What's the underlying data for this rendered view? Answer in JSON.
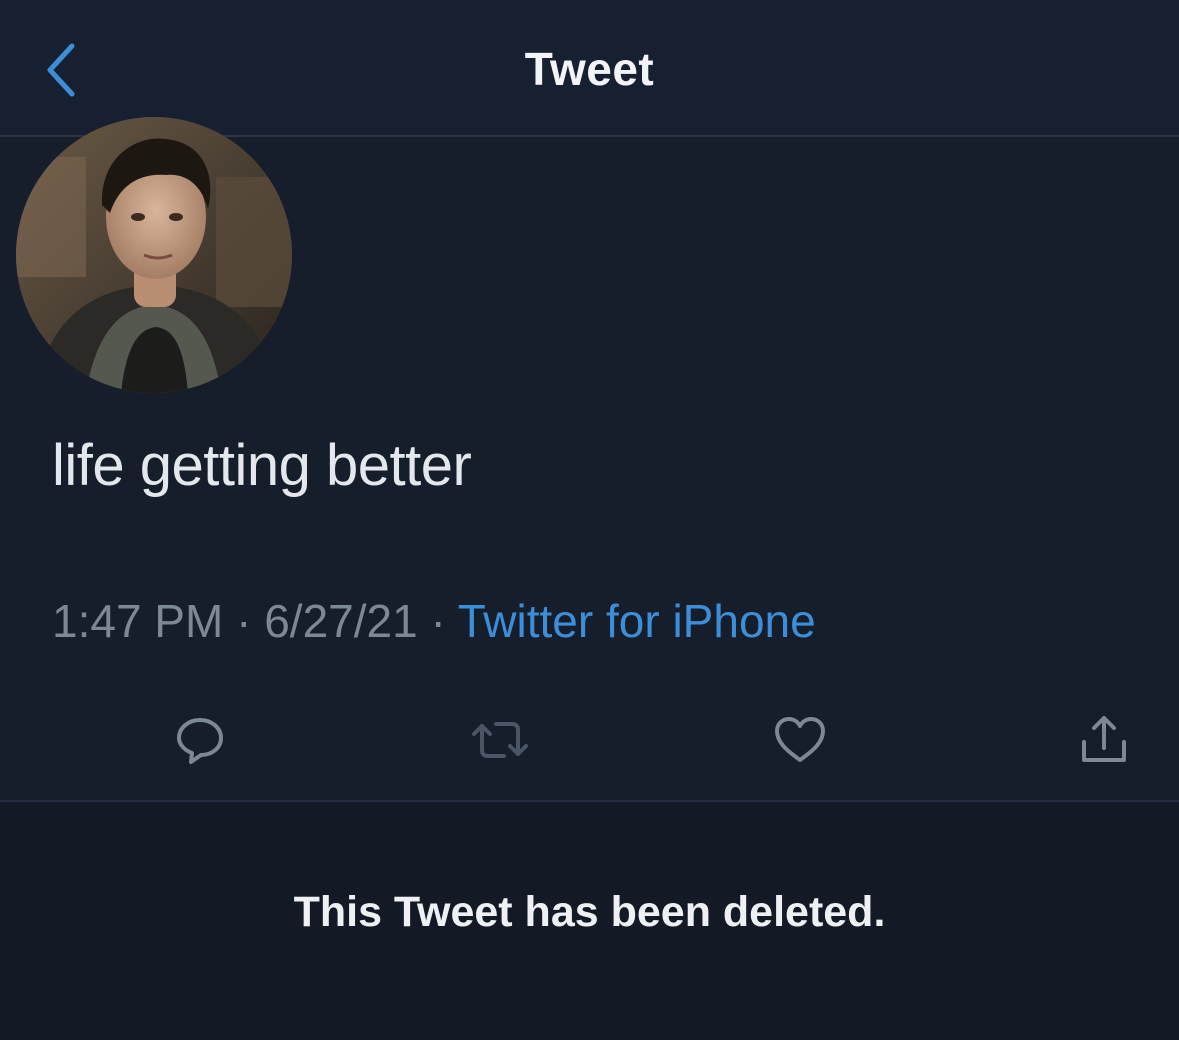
{
  "header": {
    "title": "Tweet",
    "back_icon": "chevron-left-icon"
  },
  "tweet": {
    "text": "life getting better",
    "time": "1:47 PM",
    "date": "6/27/21",
    "separator": "·",
    "source": "Twitter for iPhone"
  },
  "actions": {
    "reply_icon": "reply-icon",
    "retweet_icon": "retweet-icon",
    "like_icon": "heart-icon",
    "share_icon": "share-icon"
  },
  "notice": {
    "deleted_text": "This Tweet has been deleted."
  },
  "colors": {
    "background": "#161e2c",
    "accent": "#3d8ed8",
    "muted_text": "#7d8897",
    "icon": "#7d8897"
  }
}
